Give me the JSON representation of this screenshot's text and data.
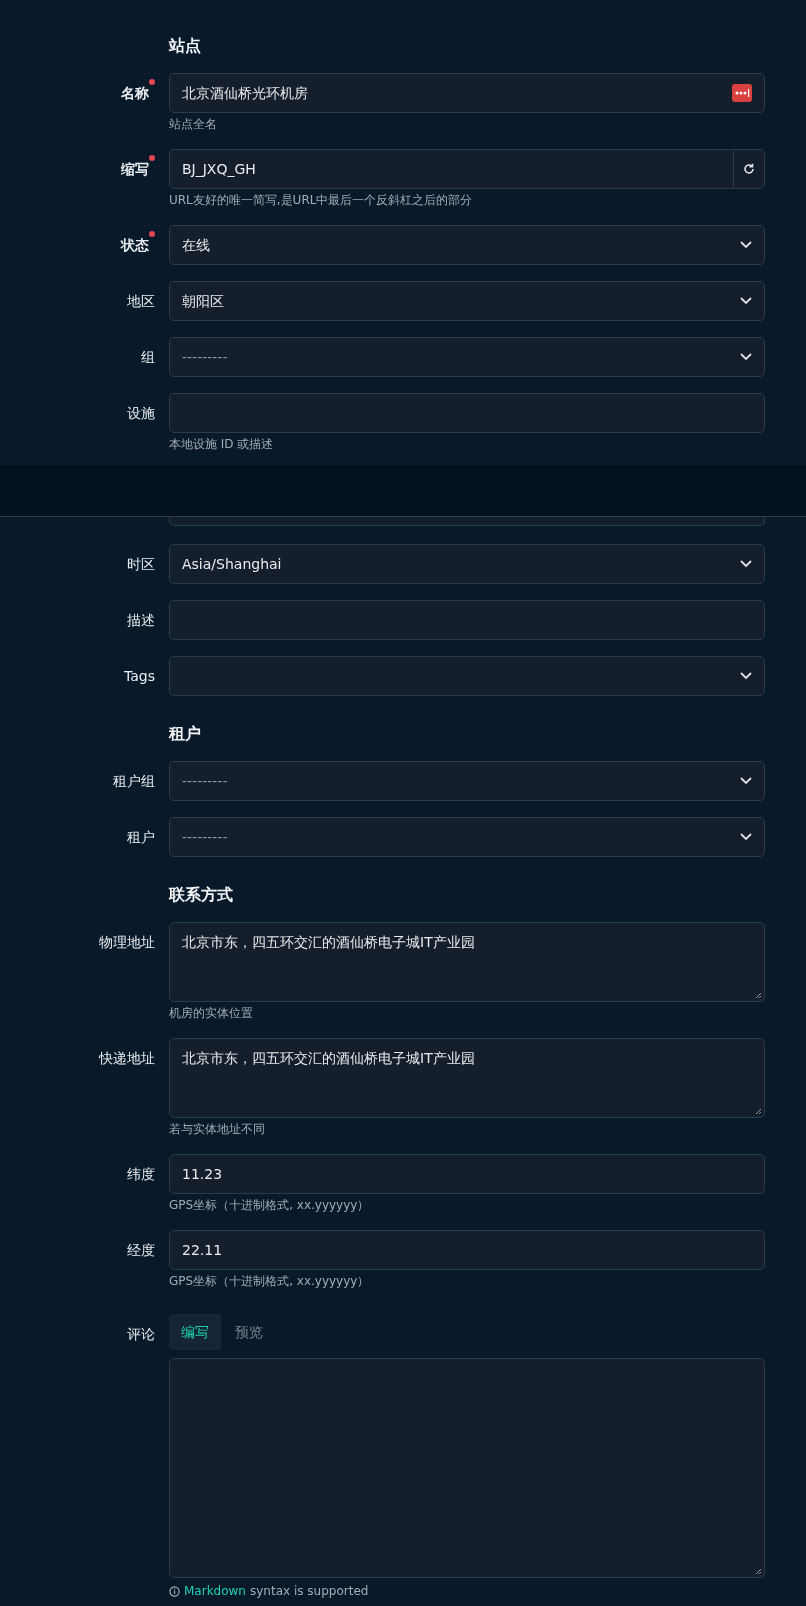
{
  "sections": [
    {
      "title": "站点",
      "fields": [
        {
          "kind": "badged",
          "label": "名称",
          "required": true,
          "value": "北京酒仙桥光环机房",
          "help": "站点全名"
        },
        {
          "kind": "regenerate",
          "label": "缩写",
          "required": true,
          "value": "BJ_JXQ_GH",
          "help": "URL友好的唯一简写,是URL中最后一个反斜杠之后的部分"
        },
        {
          "kind": "select",
          "label": "状态",
          "required": true,
          "value": "在线"
        },
        {
          "kind": "select",
          "label": "地区",
          "required": false,
          "value": "朝阳区"
        },
        {
          "kind": "select",
          "label": "组",
          "required": false,
          "placeholder": "---------"
        },
        {
          "kind": "text",
          "label": "设施",
          "required": false,
          "help": "本地设施 ID 或描述"
        },
        {
          "kind": "covered"
        },
        {
          "kind": "select",
          "label": "时区",
          "required": false,
          "value": "Asia/Shanghai"
        },
        {
          "kind": "text",
          "label": "描述",
          "required": false
        },
        {
          "kind": "select",
          "label": "Tags",
          "required": false
        }
      ]
    },
    {
      "title": "租户",
      "fields": [
        {
          "kind": "select",
          "label": "租户组",
          "required": false,
          "placeholder": "---------"
        },
        {
          "kind": "select",
          "label": "租户",
          "required": false,
          "placeholder": "---------"
        }
      ]
    },
    {
      "title": "联系方式",
      "fields": [
        {
          "kind": "textarea",
          "label": "物理地址",
          "required": false,
          "value": "北京市东，四五环交汇的酒仙桥电子城IT产业园",
          "help": "机房的实体位置"
        },
        {
          "kind": "textarea",
          "label": "快递地址",
          "required": false,
          "value": "北京市东，四五环交汇的酒仙桥电子城IT产业园",
          "help": "若与实体地址不同"
        },
        {
          "kind": "text",
          "label": "纬度",
          "required": false,
          "value": "11.23",
          "help": "GPS坐标（十进制格式, xx.yyyyyy）"
        },
        {
          "kind": "text",
          "label": "经度",
          "required": false,
          "value": "22.11",
          "help": "GPS坐标（十进制格式, xx.yyyyyy）"
        }
      ]
    }
  ],
  "comments": {
    "label": "评论",
    "tabs": [
      {
        "label": "编写",
        "selected": true
      },
      {
        "label": "预览",
        "selected": false
      }
    ],
    "hint_link": "Markdown",
    "hint_text": "syntax is supported"
  }
}
